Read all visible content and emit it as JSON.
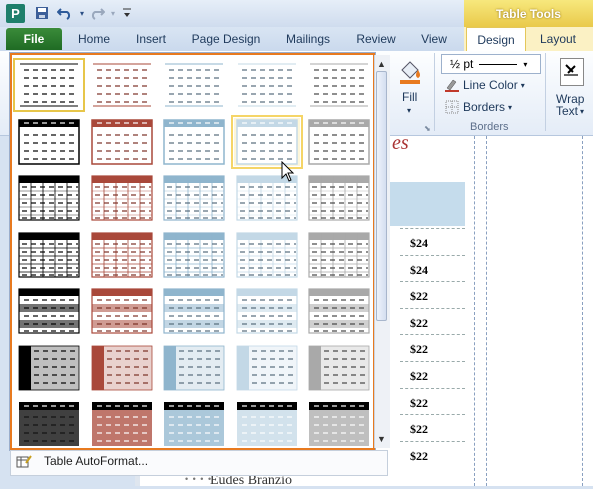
{
  "quick_access": {
    "app_icon": "P",
    "save_icon": "save-icon",
    "undo_icon": "undo-icon",
    "redo_icon": "redo-icon",
    "customize_icon": "customize-icon"
  },
  "contextual_header": "Table Tools",
  "tabs": [
    {
      "id": "file",
      "label": "File"
    },
    {
      "id": "home",
      "label": "Home"
    },
    {
      "id": "insert",
      "label": "Insert"
    },
    {
      "id": "page_design",
      "label": "Page Design"
    },
    {
      "id": "mailings",
      "label": "Mailings"
    },
    {
      "id": "review",
      "label": "Review"
    },
    {
      "id": "view",
      "label": "View"
    },
    {
      "id": "design",
      "label": "Design"
    },
    {
      "id": "layout",
      "label": "Layout"
    }
  ],
  "ribbon": {
    "fill_label": "Fill",
    "border_weight": "½ pt",
    "line_color_label": "Line Color",
    "borders_label": "Borders",
    "borders_group": "Borders",
    "wrap_label_1": "Wrap",
    "wrap_label_2": "Text"
  },
  "document": {
    "heading_fragment": "es",
    "prices": [
      "$24",
      "$24",
      "$22",
      "$22",
      "$22",
      "$22",
      "$22",
      "$22",
      "$22"
    ],
    "bottom_text": "Eudes Branzio"
  },
  "gallery": {
    "rows": 7,
    "columns": 5,
    "selected": "0,0",
    "hovered": "1,3",
    "styles": [
      [
        "plain-black",
        "plain-red",
        "plain-blue",
        "plain-lightblue",
        "plain-gray"
      ],
      [
        "header-black",
        "header-red",
        "header-blue",
        "header-lightblue",
        "header-gray"
      ],
      [
        "grid-black",
        "grid-red",
        "grid-blue",
        "grid-lightblue",
        "grid-gray"
      ],
      [
        "grid2-black",
        "grid2-red",
        "grid2-blue",
        "grid2-lightblue",
        "grid2-gray"
      ],
      [
        "band-black",
        "band-red",
        "band-blue",
        "band-lightblue",
        "band-gray"
      ],
      [
        "firstcol-black",
        "firstcol-red",
        "firstcol-blue",
        "firstcol-lightblue",
        "firstcol-gray"
      ],
      [
        "filled-black",
        "filled-red",
        "filled-blue",
        "filled-lightblue",
        "filled-gray"
      ]
    ],
    "palette": {
      "black": "#000000",
      "red": "#a9483a",
      "blue": "#8fb5cd",
      "lightblue": "#c3d8e6",
      "gray": "#a9a9a9"
    },
    "footer_label": "Table AutoFormat...",
    "footer_icon": "table-autoformat-icon"
  },
  "colors": {
    "accent_orange": "#e87a1f",
    "table_tools_gold": "#e9c94a",
    "file_green": "#2c7d2f"
  }
}
